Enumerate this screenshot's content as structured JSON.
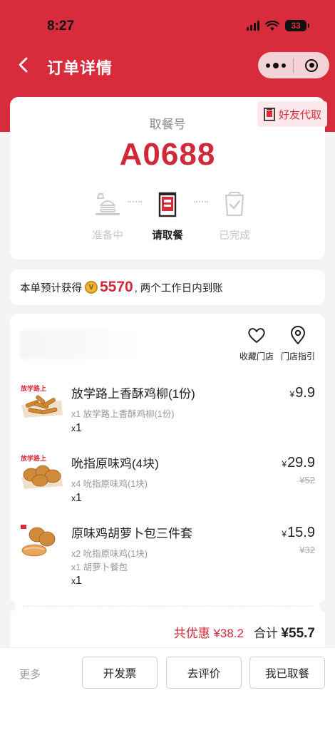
{
  "status_bar": {
    "time": "8:27",
    "battery": "33"
  },
  "nav": {
    "title": "订单详情"
  },
  "pickup": {
    "friend_tag": "好友代取",
    "label": "取餐号",
    "number": "A0688",
    "steps": [
      {
        "label": "准备中",
        "icon": "burger-tray-icon",
        "active": false
      },
      {
        "label": "请取餐",
        "icon": "kfc-bag-icon",
        "active": true
      },
      {
        "label": "已完成",
        "icon": "completed-bag-icon",
        "active": false
      }
    ]
  },
  "points": {
    "prefix": "本单预计获得",
    "coin_symbol": "V",
    "amount": "5570",
    "suffix": ", 两个工作日内到账"
  },
  "store": {
    "favorite_label": "收藏门店",
    "guide_label": "门店指引"
  },
  "items": [
    {
      "name": "放学路上香酥鸡柳(1份)",
      "details": [
        "x1 放学路上香酥鸡柳(1份)"
      ],
      "qty": "1",
      "price": "9.9",
      "original_price": ""
    },
    {
      "name": "吮指原味鸡(4块)",
      "details": [
        "x4 吮指原味鸡(1块)"
      ],
      "qty": "1",
      "price": "29.9",
      "original_price": "¥52"
    },
    {
      "name": "原味鸡胡萝卜包三件套",
      "details": [
        "x2 吮指原味鸡(1块)",
        "x1 胡萝卜餐包"
      ],
      "qty": "1",
      "price": "15.9",
      "original_price": "¥32"
    }
  ],
  "totals": {
    "discount_label": "共优惠",
    "discount_value": "¥38.2",
    "total_label": "合计",
    "total_value": "¥55.7"
  },
  "actions": {
    "more": "更多",
    "invoice": "开发票",
    "review": "去评价",
    "picked_up": "我已取餐"
  },
  "colors": {
    "brand_red": "#d82c3c",
    "price_red": "#d02a3a"
  },
  "currency_symbol": "¥",
  "qty_prefix": "x"
}
